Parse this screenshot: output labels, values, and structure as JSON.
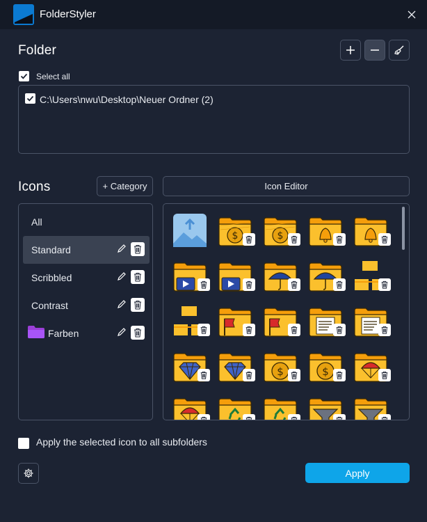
{
  "window": {
    "title": "FolderStyler",
    "close_icon": "close-icon"
  },
  "folder": {
    "heading": "Folder",
    "select_all_label": "Select all",
    "select_all_checked": true,
    "paths": [
      {
        "path": "C:\\Users\\nwu\\Desktop\\Neuer Ordner (2)",
        "checked": true
      }
    ],
    "toolbar": {
      "add_icon": "plus-icon",
      "remove_icon": "minus-icon",
      "clear_icon": "broom-icon"
    }
  },
  "icons": {
    "heading": "Icons",
    "add_category_label": "+ Category",
    "icon_editor_label": "Icon Editor",
    "categories": [
      {
        "label": "All",
        "editable": false
      },
      {
        "label": "Standard",
        "editable": true,
        "selected": true
      },
      {
        "label": "Scribbled",
        "editable": true
      },
      {
        "label": "Contrast",
        "editable": true
      },
      {
        "label": "Farben",
        "editable": true,
        "folder_color": "#9b3fd8"
      }
    ],
    "grid": [
      [
        "image-upload",
        "dollar-scribbled",
        "dollar-scribbled",
        "bell",
        "bell"
      ],
      [
        "video",
        "video",
        "umbrella",
        "umbrella",
        "small-folders"
      ],
      [
        "small-folders",
        "flag",
        "flag",
        "document",
        "document"
      ],
      [
        "diamond",
        "diamond",
        "dollar",
        "dollar",
        "parachute"
      ],
      [
        "parachute",
        "recycle",
        "recycle",
        "funnel",
        "funnel"
      ]
    ]
  },
  "subfolders": {
    "label": "Apply the selected icon to all subfolders",
    "checked": false
  },
  "footer": {
    "settings_icon": "gear-icon",
    "apply_label": "Apply"
  },
  "colors": {
    "background": "#1c2333",
    "titlebar": "#141a26",
    "accent": "#0ea5e9",
    "folder": "#fbc02d",
    "folder_outline": "#3a2a05"
  }
}
